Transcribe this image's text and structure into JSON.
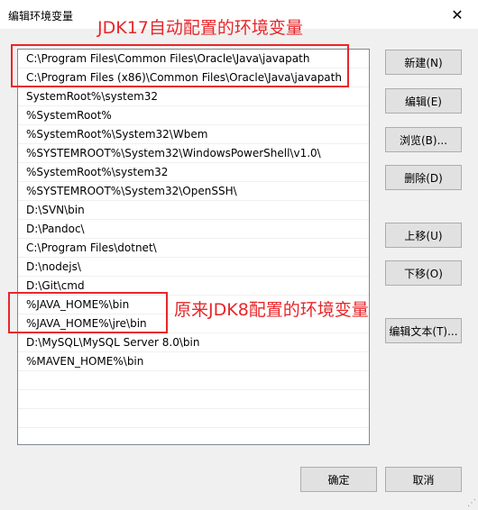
{
  "window": {
    "title": "编辑环境变量",
    "close_glyph": "✕"
  },
  "path_entries": [
    "C:\\Program Files\\Common Files\\Oracle\\Java\\javapath",
    "C:\\Program Files (x86)\\Common Files\\Oracle\\Java\\javapath",
    "SystemRoot%\\system32",
    "%SystemRoot%",
    "%SystemRoot%\\System32\\Wbem",
    "%SYSTEMROOT%\\System32\\WindowsPowerShell\\v1.0\\",
    "%SystemRoot%\\system32",
    "%SYSTEMROOT%\\System32\\OpenSSH\\",
    "D:\\SVN\\bin",
    "D:\\Pandoc\\",
    "C:\\Program Files\\dotnet\\",
    "D:\\nodejs\\",
    "D:\\Git\\cmd",
    "%JAVA_HOME%\\bin",
    "%JAVA_HOME%\\jre\\bin",
    "D:\\MySQL\\MySQL Server 8.0\\bin",
    "%MAVEN_HOME%\\bin"
  ],
  "buttons": {
    "new": "新建(N)",
    "edit": "编辑(E)",
    "browse": "浏览(B)...",
    "delete": "删除(D)",
    "move_up": "上移(U)",
    "move_down": "下移(O)",
    "edit_text": "编辑文本(T)...",
    "ok": "确定",
    "cancel": "取消"
  },
  "annotations": {
    "jdk17": "JDK17自动配置的环境变量",
    "jdk8": "原来JDK8配置的环境变量",
    "color": "#e8262a"
  }
}
